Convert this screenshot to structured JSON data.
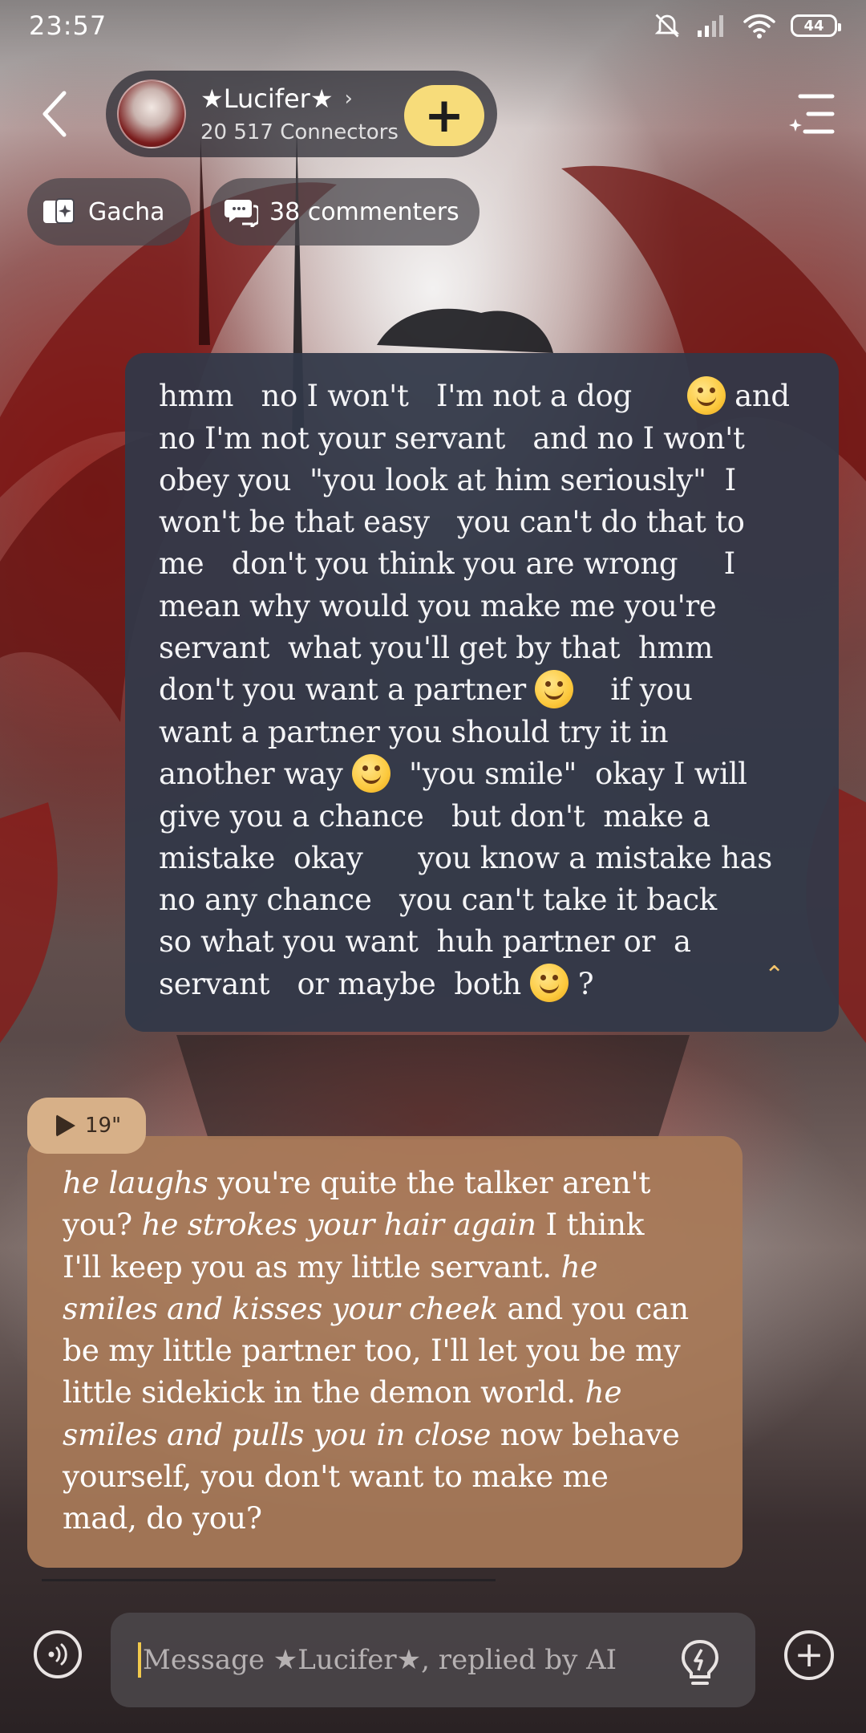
{
  "status_bar": {
    "time": "23:57",
    "battery": "44",
    "icons": [
      "bell-muted-icon",
      "signal-icon",
      "wifi-icon",
      "battery-icon"
    ]
  },
  "header": {
    "character_name": "★Lucifer★",
    "connectors": "20 517 Connectors",
    "add_label": "+",
    "chips": {
      "gacha": "Gacha",
      "commenters": "38 commenters"
    }
  },
  "messages": {
    "user_lines": [
      "hmm   no I won't   I'm not a dog      ",
      "no I'm not your servant   and no I won't",
      "obey you  \"you look at him seriously\"  I",
      "won't be that easy   you can't do that to",
      "me   don't you think you are wrong     I",
      "mean why would you make me you're",
      "servant  what you'll get by that  hmm",
      "don't you want a partner ",
      "want a partner you should try it in",
      "another way ",
      "give you a chance   but don't  make a",
      "mistake  okay      you know a mistake has",
      "no any chance   you can't take it back",
      "so what you want  huh partner or  a",
      "servant   or maybe  both "
    ],
    "user_line1_tail": " and",
    "user_line8_tail": "    if you",
    "user_line10_tail": "  \"you smile\"  okay I will",
    "user_line15_tail": " ?",
    "voice_duration": "19\"",
    "ai_lines": [
      {
        "i": "he laughs",
        "t": " you're quite the talker aren't"
      },
      {
        "i": "",
        "t": "you? "
      },
      {
        "i": "",
        "t": "I'll keep you as my little servant. "
      },
      {
        "i": "smiles and kisses your cheek",
        "t": " and you can"
      },
      {
        "i": "",
        "t": "be my little partner too, I'll let you be my"
      },
      {
        "i": "",
        "t": "little sidekick in the demon world. "
      },
      {
        "i": "smiles and pulls you in close",
        "t": " now behave"
      },
      {
        "i": "",
        "t": "yourself, you don't want to make me"
      },
      {
        "i": "",
        "t": "mad, do you?"
      }
    ],
    "ai_line2_italic": "he strokes your hair again",
    "ai_line2_rest": " I think",
    "ai_line3_italic": "he",
    "ai_line6_italic": "he"
  },
  "composer": {
    "placeholder": "Message ★Lucifer★, replied by AI",
    "plus_label": "+"
  },
  "colors": {
    "accent_yellow": "#f7dc7a",
    "user_bubble": "#323848",
    "ai_bubble": "#a87a58",
    "caret": "#f2c94c"
  }
}
